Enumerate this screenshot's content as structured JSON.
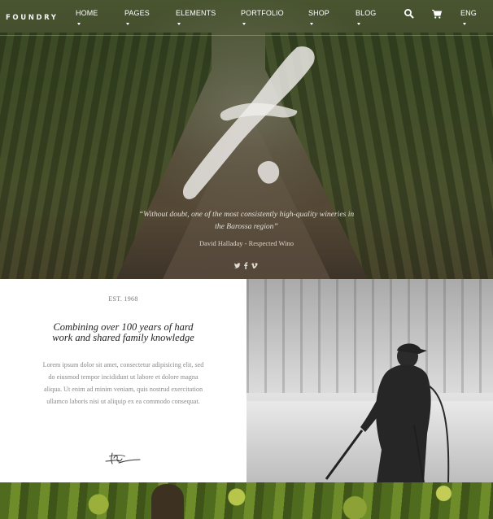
{
  "brand": {
    "logo": "FOUNDRY"
  },
  "nav": {
    "items": [
      {
        "label": "HOME"
      },
      {
        "label": "PAGES"
      },
      {
        "label": "ELEMENTS"
      },
      {
        "label": "PORTFOLIO"
      },
      {
        "label": "SHOP"
      },
      {
        "label": "BLOG"
      }
    ],
    "icons": [
      "search-icon",
      "cart-icon"
    ],
    "language": "ENG"
  },
  "hero": {
    "quote": "“Without doubt, one of the most consistently high-quality wineries in the Barossa region”",
    "author": "David Halladay - Respected Wino",
    "social_icons": [
      "twitter-icon",
      "facebook-icon",
      "vimeo-icon"
    ]
  },
  "about": {
    "established": "EST. 1968",
    "title": "Combining over 100 years of hard work and shared family knowledge",
    "body": "Lorem ipsum dolor sit amet, consectetur adipisicing elit, sed do eiusmod tempor incididunt ut labore et dolore magna aliqua. Ut enim ad minim veniam, quis nostrud exercitation ullamco laboris nisi ut aliquip ex ea commodo consequat."
  },
  "colors": {
    "nav_text": "#ffffff",
    "title_text": "#222222",
    "body_text": "#8a8a8a"
  }
}
